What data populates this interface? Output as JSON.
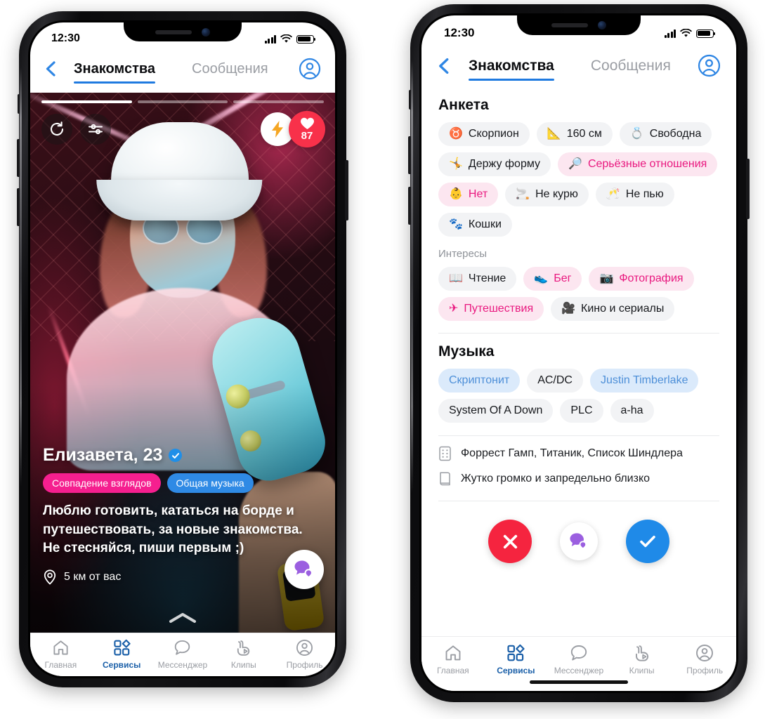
{
  "status_bar": {
    "time": "12:30",
    "signal_icon": "cellular-bars-icon",
    "wifi_icon": "wifi-icon",
    "battery_icon": "battery-icon"
  },
  "header": {
    "back_icon": "back-chevron-icon",
    "tabs": [
      {
        "label": "Знакомства",
        "active": true
      },
      {
        "label": "Сообщения",
        "active": false
      }
    ],
    "account_icon": "account-circle-icon"
  },
  "colors": {
    "accent_blue": "#1f7ae0",
    "pink": "#f51f8f",
    "magenta_text": "#e9187f",
    "chip_bg": "#f2f3f5",
    "chip_pink_bg": "#fce6f0",
    "chip_blue_bg": "#dbeafb",
    "chip_blue_text": "#4d8fd8",
    "reject_red": "#f5243f",
    "accept_blue": "#1f8ae8",
    "likes_red": "#f8314a"
  },
  "card": {
    "progress": {
      "segments": 3,
      "current": 1
    },
    "controls": {
      "undo_icon": "undo-rotate-icon",
      "filters_icon": "sliders-filter-icon",
      "boost_icon": "lightning-bolt-icon",
      "likes_icon": "heart-icon",
      "likes_count": "87"
    },
    "name": "Елизавета, 23",
    "verified_icon": "verified-check-icon",
    "badges": [
      {
        "label": "Совпадение взглядов",
        "style": "pink"
      },
      {
        "label": "Общая музыка",
        "style": "blue"
      }
    ],
    "bio": "Люблю готовить, кататься на борде и путешествовать, за новые знакомства. Не стесняйся, пиши первым ;)",
    "distance_icon": "location-pin-icon",
    "distance": "5 км от вас",
    "chat_fab_icon": "chat-heart-icon",
    "expand_icon": "chevron-up-icon"
  },
  "profile": {
    "anketa": {
      "title": "Анкета",
      "chips": [
        {
          "emoji": "♉",
          "label": "Скорпион",
          "style": "plain"
        },
        {
          "emoji": "📐",
          "label": "160 см",
          "style": "plain"
        },
        {
          "emoji": "💍",
          "label": "Свободна",
          "style": "plain"
        },
        {
          "emoji": "🤸",
          "label": "Держу форму",
          "style": "plain"
        },
        {
          "emoji": "🔎",
          "label": "Серьёзные отношения",
          "style": "pink"
        },
        {
          "emoji": "👶",
          "label": "Нет",
          "style": "pink"
        },
        {
          "emoji": "🚬",
          "label": "Не курю",
          "style": "plain"
        },
        {
          "emoji": "🥂",
          "label": "Не пью",
          "style": "plain"
        },
        {
          "emoji": "🐾",
          "label": "Кошки",
          "style": "plain"
        }
      ]
    },
    "interests": {
      "title": "Интересы",
      "chips": [
        {
          "emoji": "📖",
          "label": "Чтение",
          "style": "plain"
        },
        {
          "emoji": "👟",
          "label": "Бег",
          "style": "pink"
        },
        {
          "emoji": "📷",
          "label": "Фотография",
          "style": "pink"
        },
        {
          "emoji": "✈",
          "label": "Путешествия",
          "style": "pink"
        },
        {
          "emoji": "🎥",
          "label": "Кино и сериалы",
          "style": "plain"
        }
      ]
    },
    "music": {
      "title": "Музыка",
      "chips": [
        {
          "label": "Скриптонит",
          "style": "blue"
        },
        {
          "label": "AC/DC",
          "style": "plain"
        },
        {
          "label": "Justin Timberlake",
          "style": "blue"
        },
        {
          "label": "System Of A Down",
          "style": "plain"
        },
        {
          "label": "PLC",
          "style": "plain"
        },
        {
          "label": "a-ha",
          "style": "plain"
        }
      ]
    },
    "facts": [
      {
        "icon": "film-clapper-icon",
        "text": "Форрест Гамп, Титаник, Список Шиндлера"
      },
      {
        "icon": "book-icon",
        "text": "Жутко громко и запредельно близко"
      }
    ],
    "actions": [
      {
        "name": "reject-button",
        "icon": "close-x-icon"
      },
      {
        "name": "message-button",
        "icon": "chat-heart-icon"
      },
      {
        "name": "accept-button",
        "icon": "check-icon"
      }
    ]
  },
  "bottom_nav": [
    {
      "label": "Главная",
      "icon": "home-icon",
      "active": false
    },
    {
      "label": "Сервисы",
      "icon": "services-grid-icon",
      "active": true
    },
    {
      "label": "Мессенджер",
      "icon": "chat-bubble-icon",
      "active": false
    },
    {
      "label": "Клипы",
      "icon": "clips-icon",
      "active": false
    },
    {
      "label": "Профиль",
      "icon": "profile-circle-icon",
      "active": false
    }
  ]
}
